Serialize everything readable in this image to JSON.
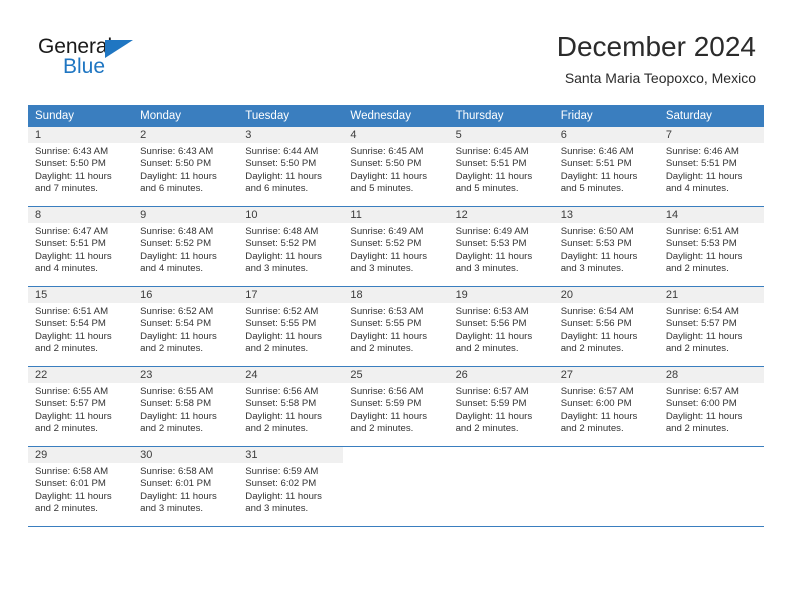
{
  "brand": {
    "name_top": "General",
    "name_bottom": "Blue",
    "primary_color": "#1f76c2"
  },
  "header": {
    "title": "December 2024",
    "subtitle": "Santa Maria Teopoxco, Mexico"
  },
  "calendar": {
    "header_color": "#3a7ebf",
    "daynum_band_color": "#f0f0f0",
    "weekday_headers": [
      "Sunday",
      "Monday",
      "Tuesday",
      "Wednesday",
      "Thursday",
      "Friday",
      "Saturday"
    ],
    "weeks": [
      [
        {
          "day": "1",
          "sunrise": "Sunrise: 6:43 AM",
          "sunset": "Sunset: 5:50 PM",
          "daylight_1": "Daylight: 11 hours",
          "daylight_2": "and 7 minutes."
        },
        {
          "day": "2",
          "sunrise": "Sunrise: 6:43 AM",
          "sunset": "Sunset: 5:50 PM",
          "daylight_1": "Daylight: 11 hours",
          "daylight_2": "and 6 minutes."
        },
        {
          "day": "3",
          "sunrise": "Sunrise: 6:44 AM",
          "sunset": "Sunset: 5:50 PM",
          "daylight_1": "Daylight: 11 hours",
          "daylight_2": "and 6 minutes."
        },
        {
          "day": "4",
          "sunrise": "Sunrise: 6:45 AM",
          "sunset": "Sunset: 5:50 PM",
          "daylight_1": "Daylight: 11 hours",
          "daylight_2": "and 5 minutes."
        },
        {
          "day": "5",
          "sunrise": "Sunrise: 6:45 AM",
          "sunset": "Sunset: 5:51 PM",
          "daylight_1": "Daylight: 11 hours",
          "daylight_2": "and 5 minutes."
        },
        {
          "day": "6",
          "sunrise": "Sunrise: 6:46 AM",
          "sunset": "Sunset: 5:51 PM",
          "daylight_1": "Daylight: 11 hours",
          "daylight_2": "and 5 minutes."
        },
        {
          "day": "7",
          "sunrise": "Sunrise: 6:46 AM",
          "sunset": "Sunset: 5:51 PM",
          "daylight_1": "Daylight: 11 hours",
          "daylight_2": "and 4 minutes."
        }
      ],
      [
        {
          "day": "8",
          "sunrise": "Sunrise: 6:47 AM",
          "sunset": "Sunset: 5:51 PM",
          "daylight_1": "Daylight: 11 hours",
          "daylight_2": "and 4 minutes."
        },
        {
          "day": "9",
          "sunrise": "Sunrise: 6:48 AM",
          "sunset": "Sunset: 5:52 PM",
          "daylight_1": "Daylight: 11 hours",
          "daylight_2": "and 4 minutes."
        },
        {
          "day": "10",
          "sunrise": "Sunrise: 6:48 AM",
          "sunset": "Sunset: 5:52 PM",
          "daylight_1": "Daylight: 11 hours",
          "daylight_2": "and 3 minutes."
        },
        {
          "day": "11",
          "sunrise": "Sunrise: 6:49 AM",
          "sunset": "Sunset: 5:52 PM",
          "daylight_1": "Daylight: 11 hours",
          "daylight_2": "and 3 minutes."
        },
        {
          "day": "12",
          "sunrise": "Sunrise: 6:49 AM",
          "sunset": "Sunset: 5:53 PM",
          "daylight_1": "Daylight: 11 hours",
          "daylight_2": "and 3 minutes."
        },
        {
          "day": "13",
          "sunrise": "Sunrise: 6:50 AM",
          "sunset": "Sunset: 5:53 PM",
          "daylight_1": "Daylight: 11 hours",
          "daylight_2": "and 3 minutes."
        },
        {
          "day": "14",
          "sunrise": "Sunrise: 6:51 AM",
          "sunset": "Sunset: 5:53 PM",
          "daylight_1": "Daylight: 11 hours",
          "daylight_2": "and 2 minutes."
        }
      ],
      [
        {
          "day": "15",
          "sunrise": "Sunrise: 6:51 AM",
          "sunset": "Sunset: 5:54 PM",
          "daylight_1": "Daylight: 11 hours",
          "daylight_2": "and 2 minutes."
        },
        {
          "day": "16",
          "sunrise": "Sunrise: 6:52 AM",
          "sunset": "Sunset: 5:54 PM",
          "daylight_1": "Daylight: 11 hours",
          "daylight_2": "and 2 minutes."
        },
        {
          "day": "17",
          "sunrise": "Sunrise: 6:52 AM",
          "sunset": "Sunset: 5:55 PM",
          "daylight_1": "Daylight: 11 hours",
          "daylight_2": "and 2 minutes."
        },
        {
          "day": "18",
          "sunrise": "Sunrise: 6:53 AM",
          "sunset": "Sunset: 5:55 PM",
          "daylight_1": "Daylight: 11 hours",
          "daylight_2": "and 2 minutes."
        },
        {
          "day": "19",
          "sunrise": "Sunrise: 6:53 AM",
          "sunset": "Sunset: 5:56 PM",
          "daylight_1": "Daylight: 11 hours",
          "daylight_2": "and 2 minutes."
        },
        {
          "day": "20",
          "sunrise": "Sunrise: 6:54 AM",
          "sunset": "Sunset: 5:56 PM",
          "daylight_1": "Daylight: 11 hours",
          "daylight_2": "and 2 minutes."
        },
        {
          "day": "21",
          "sunrise": "Sunrise: 6:54 AM",
          "sunset": "Sunset: 5:57 PM",
          "daylight_1": "Daylight: 11 hours",
          "daylight_2": "and 2 minutes."
        }
      ],
      [
        {
          "day": "22",
          "sunrise": "Sunrise: 6:55 AM",
          "sunset": "Sunset: 5:57 PM",
          "daylight_1": "Daylight: 11 hours",
          "daylight_2": "and 2 minutes."
        },
        {
          "day": "23",
          "sunrise": "Sunrise: 6:55 AM",
          "sunset": "Sunset: 5:58 PM",
          "daylight_1": "Daylight: 11 hours",
          "daylight_2": "and 2 minutes."
        },
        {
          "day": "24",
          "sunrise": "Sunrise: 6:56 AM",
          "sunset": "Sunset: 5:58 PM",
          "daylight_1": "Daylight: 11 hours",
          "daylight_2": "and 2 minutes."
        },
        {
          "day": "25",
          "sunrise": "Sunrise: 6:56 AM",
          "sunset": "Sunset: 5:59 PM",
          "daylight_1": "Daylight: 11 hours",
          "daylight_2": "and 2 minutes."
        },
        {
          "day": "26",
          "sunrise": "Sunrise: 6:57 AM",
          "sunset": "Sunset: 5:59 PM",
          "daylight_1": "Daylight: 11 hours",
          "daylight_2": "and 2 minutes."
        },
        {
          "day": "27",
          "sunrise": "Sunrise: 6:57 AM",
          "sunset": "Sunset: 6:00 PM",
          "daylight_1": "Daylight: 11 hours",
          "daylight_2": "and 2 minutes."
        },
        {
          "day": "28",
          "sunrise": "Sunrise: 6:57 AM",
          "sunset": "Sunset: 6:00 PM",
          "daylight_1": "Daylight: 11 hours",
          "daylight_2": "and 2 minutes."
        }
      ],
      [
        {
          "day": "29",
          "sunrise": "Sunrise: 6:58 AM",
          "sunset": "Sunset: 6:01 PM",
          "daylight_1": "Daylight: 11 hours",
          "daylight_2": "and 2 minutes."
        },
        {
          "day": "30",
          "sunrise": "Sunrise: 6:58 AM",
          "sunset": "Sunset: 6:01 PM",
          "daylight_1": "Daylight: 11 hours",
          "daylight_2": "and 3 minutes."
        },
        {
          "day": "31",
          "sunrise": "Sunrise: 6:59 AM",
          "sunset": "Sunset: 6:02 PM",
          "daylight_1": "Daylight: 11 hours",
          "daylight_2": "and 3 minutes."
        },
        null,
        null,
        null,
        null
      ]
    ]
  }
}
